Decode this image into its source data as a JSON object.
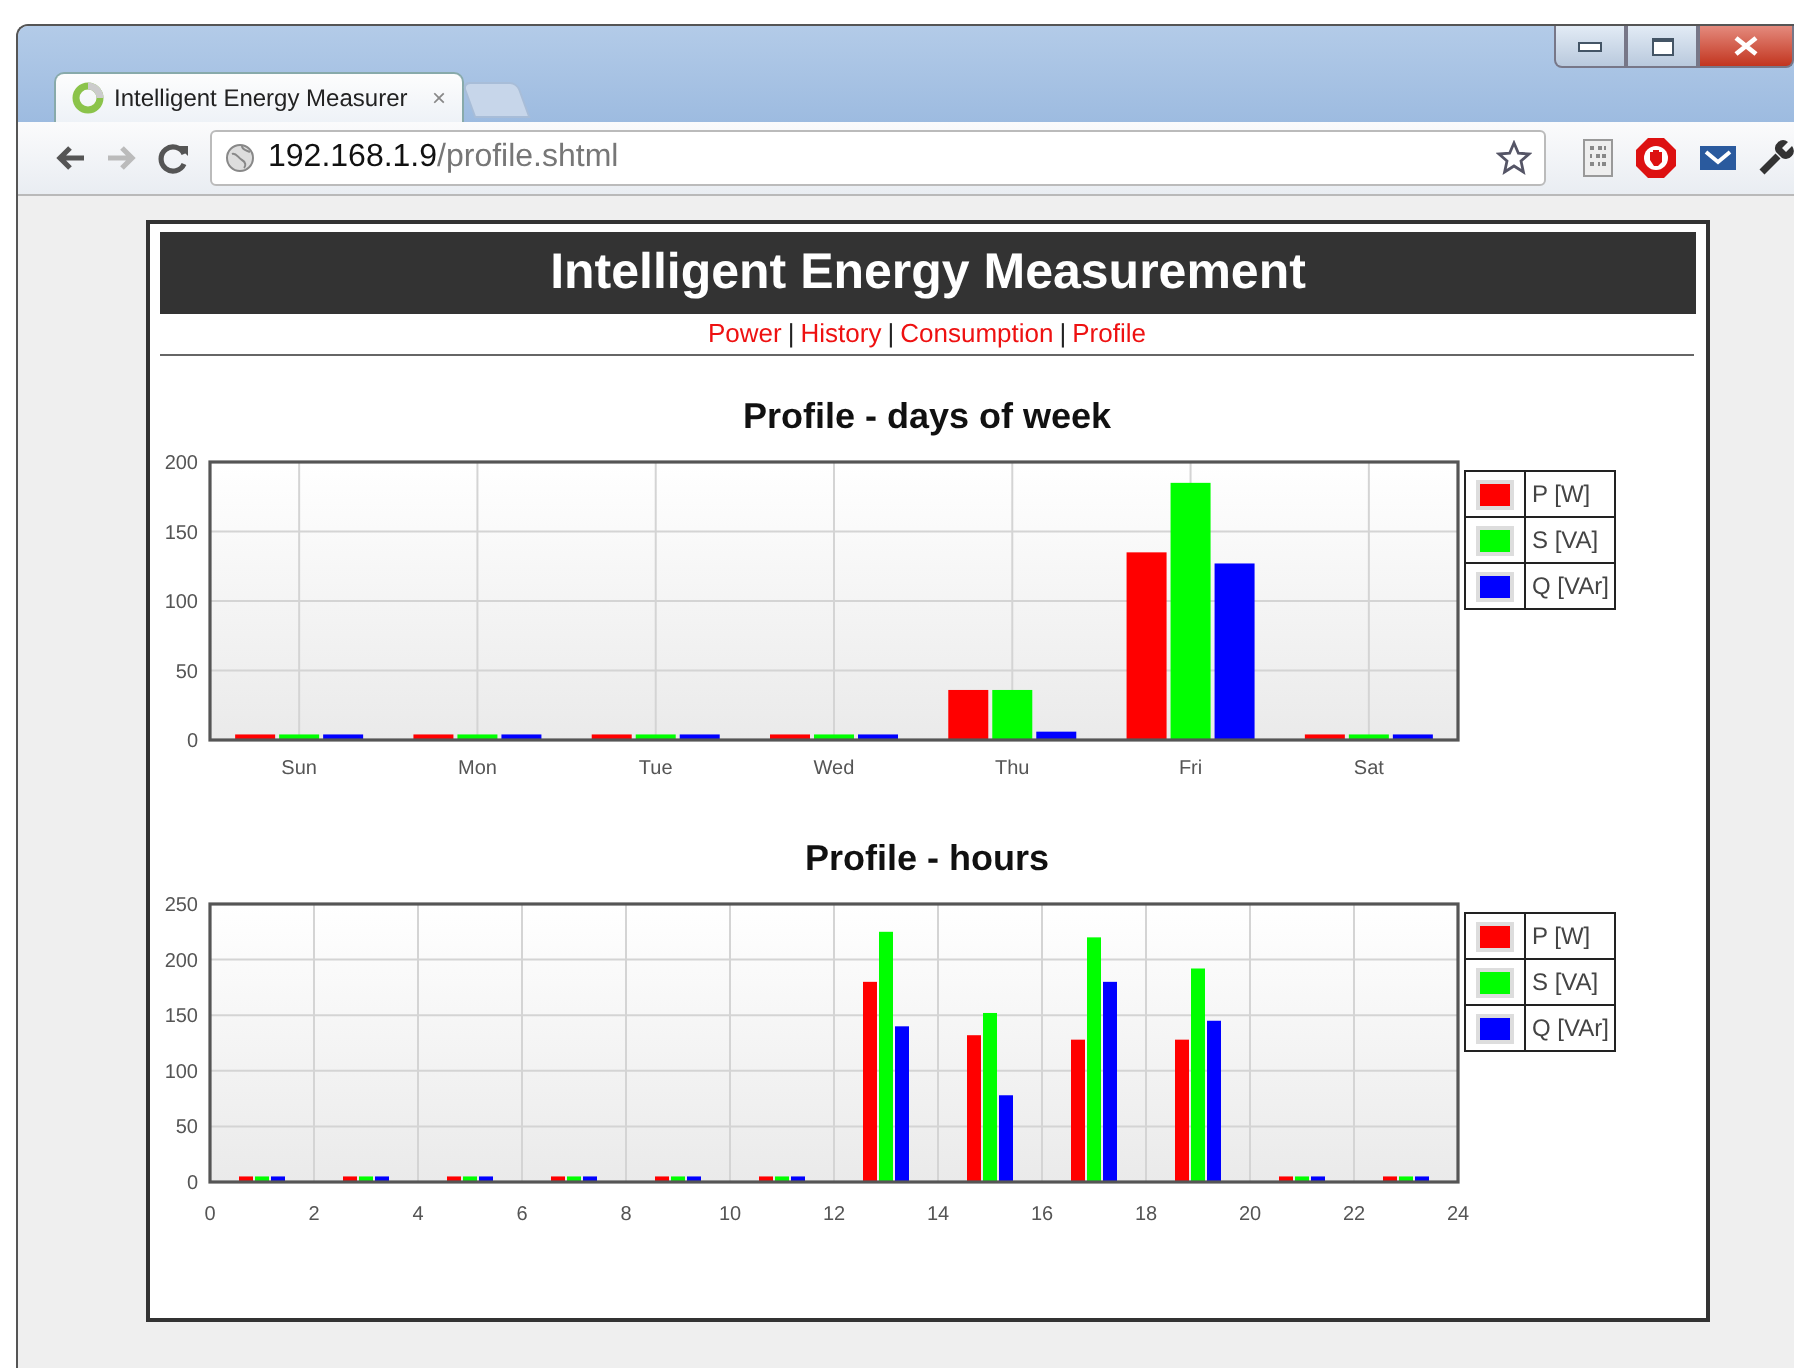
{
  "browser": {
    "tab": {
      "title": "Intelligent Energy Measurer",
      "close": "×",
      "selected": true
    },
    "url": {
      "host": "192.168.1.9",
      "path": "/profile.shtml"
    }
  },
  "page": {
    "title": "Intelligent Energy Measurement",
    "nav": {
      "separator": "|",
      "links": [
        "Power",
        "History",
        "Consumption",
        "Profile"
      ]
    },
    "charts": [
      {
        "title": "Profile - days of week",
        "chart_data": {
          "type": "bar",
          "grid": true,
          "categories": [
            "Sun",
            "Mon",
            "Tue",
            "Wed",
            "Thu",
            "Fri",
            "Sat"
          ],
          "ylim": [
            0,
            200
          ],
          "yticks": [
            0,
            50,
            100,
            150,
            200
          ],
          "series": [
            {
              "name": "P [W]",
              "color": "#ff0000",
              "values": [
                4,
                4,
                4,
                4,
                36,
                135,
                4
              ]
            },
            {
              "name": "S [VA]",
              "color": "#00ff00",
              "values": [
                4,
                4,
                4,
                4,
                36,
                185,
                4
              ]
            },
            {
              "name": "Q [VAr]",
              "color": "#0000ff",
              "values": [
                4,
                4,
                4,
                4,
                6,
                127,
                4
              ]
            }
          ]
        }
      },
      {
        "title": "Profile - hours",
        "chart_data": {
          "type": "bar",
          "grid": true,
          "x": [
            1,
            3,
            5,
            7,
            9,
            11,
            13,
            15,
            17,
            19,
            21,
            23
          ],
          "xlim": [
            0,
            24
          ],
          "xticks": [
            0,
            2,
            4,
            6,
            8,
            10,
            12,
            14,
            16,
            18,
            20,
            22,
            24
          ],
          "ylim": [
            0,
            250
          ],
          "yticks": [
            0,
            50,
            100,
            150,
            200,
            250
          ],
          "series": [
            {
              "name": "P [W]",
              "color": "#ff0000",
              "values": [
                5,
                5,
                5,
                5,
                5,
                5,
                180,
                132,
                128,
                128,
                5,
                5
              ]
            },
            {
              "name": "S [VA]",
              "color": "#00ff00",
              "values": [
                5,
                5,
                5,
                5,
                5,
                5,
                225,
                152,
                220,
                192,
                5,
                5
              ]
            },
            {
              "name": "Q [VAr]",
              "color": "#0000ff",
              "values": [
                5,
                5,
                5,
                5,
                5,
                5,
                140,
                78,
                180,
                145,
                5,
                5
              ]
            }
          ]
        }
      }
    ]
  }
}
